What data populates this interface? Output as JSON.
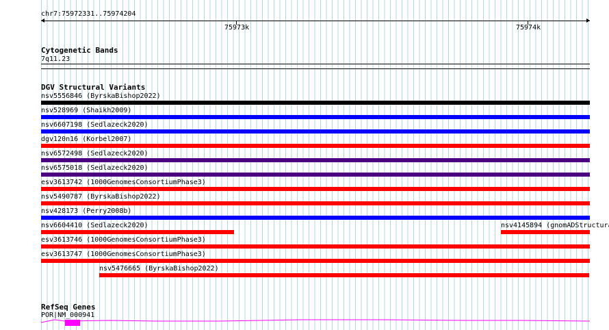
{
  "ruler": {
    "coords": "chr7:75972331..75974204",
    "tick_labels": [
      "75973k",
      "75974k"
    ]
  },
  "tracks": {
    "cytobands": {
      "title": "Cytogenetic Bands",
      "band": "7q11.23"
    },
    "dgv": {
      "title": "DGV Structural Variants",
      "features": [
        {
          "label": "nsv5556846 (ByrskaBishop2022)",
          "color": "#000000"
        },
        {
          "label": "nsv528969 (Shaikh2009)",
          "color": "#0000ff"
        },
        {
          "label": "nsv6607198 (Sedlazeck2020)",
          "color": "#0000ff"
        },
        {
          "label": "dgv120n16 (Korbel2007)",
          "color": "#ff0000"
        },
        {
          "label": "nsv6572498 (Sedlazeck2020)",
          "color": "#4b0082"
        },
        {
          "label": "nsv6575018 (Sedlazeck2020)",
          "color": "#4b0082"
        },
        {
          "label": "esv3613742 (1000GenomesConsortiumPhase3)",
          "color": "#ff0000"
        },
        {
          "label": "nsv5490787 (ByrskaBishop2022)",
          "color": "#ff0000"
        },
        {
          "label": "nsv428173 (Perry2008b)",
          "color": "#0000ff"
        },
        {
          "label": "nsv6604410 (Sedlazeck2020)",
          "color": "#ff0000"
        },
        {
          "label": "nsv4145894 (gnomADStructura",
          "color": "#ff0000"
        },
        {
          "label": "esv3613746 (1000GenomesConsortiumPhase3)",
          "color": "#ff0000"
        },
        {
          "label": "esv3613747 (1000GenomesConsortiumPhase3)",
          "color": "#ff0000"
        },
        {
          "label": "nsv5476665 (ByrskaBishop2022)",
          "color": "#ff0000"
        }
      ]
    },
    "refseq": {
      "title": "RefSeq Genes",
      "gene_label": "POR|NM_000941",
      "color": "#ff00ff"
    }
  }
}
